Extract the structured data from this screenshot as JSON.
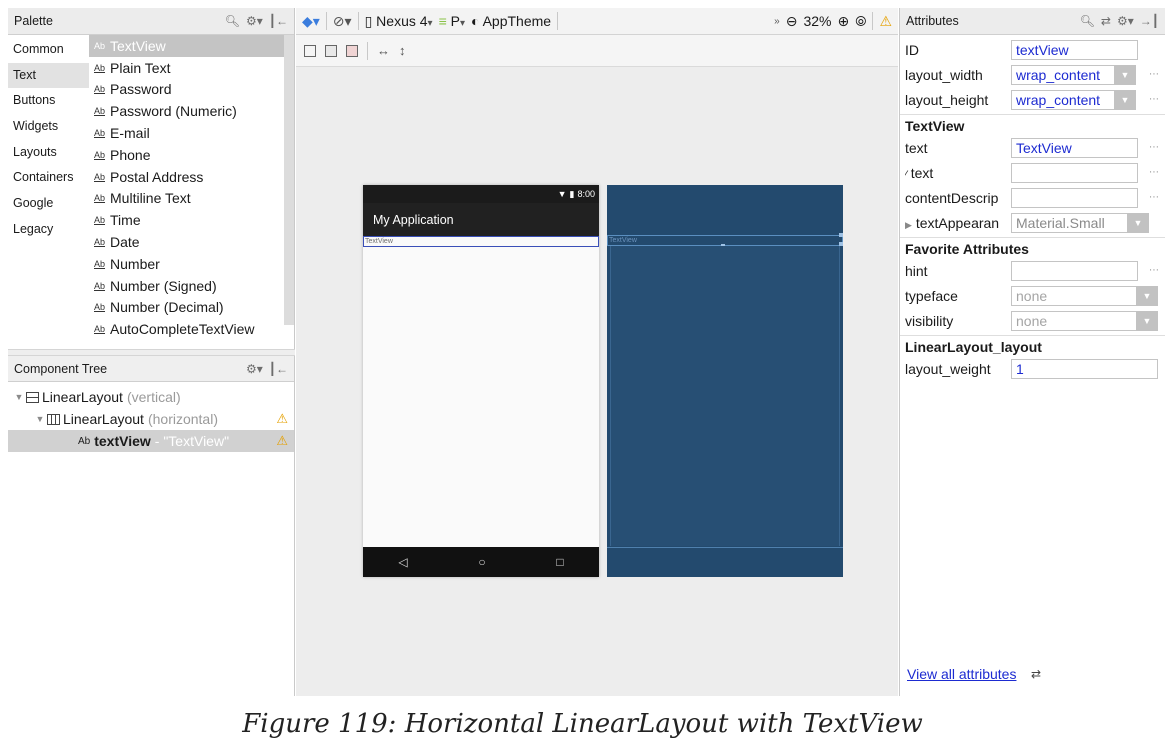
{
  "palette": {
    "title": "Palette",
    "categories": [
      "Common",
      "Text",
      "Buttons",
      "Widgets",
      "Layouts",
      "Containers",
      "Google",
      "Legacy"
    ],
    "selected_category": "Text",
    "items": [
      {
        "label": "TextView",
        "ab": "Ab"
      },
      {
        "label": "Plain Text",
        "ab": "Ab"
      },
      {
        "label": "Password",
        "ab": "Ab"
      },
      {
        "label": "Password (Numeric)",
        "ab": "Ab"
      },
      {
        "label": "E-mail",
        "ab": "Ab"
      },
      {
        "label": "Phone",
        "ab": "Ab"
      },
      {
        "label": "Postal Address",
        "ab": "Ab"
      },
      {
        "label": "Multiline Text",
        "ab": "Ab"
      },
      {
        "label": "Time",
        "ab": "Ab"
      },
      {
        "label": "Date",
        "ab": "Ab"
      },
      {
        "label": "Number",
        "ab": "Ab"
      },
      {
        "label": "Number (Signed)",
        "ab": "Ab"
      },
      {
        "label": "Number (Decimal)",
        "ab": "Ab"
      },
      {
        "label": "AutoCompleteTextView",
        "ab": "Ab"
      }
    ]
  },
  "component_tree": {
    "title": "Component Tree",
    "nodes": [
      {
        "name": "LinearLayout",
        "hint": "(vertical)"
      },
      {
        "name": "LinearLayout",
        "hint": "(horizontal)"
      },
      {
        "name": "textView",
        "hint": "- \"TextView\"",
        "ab": "Ab"
      }
    ]
  },
  "toolbar": {
    "device": "Nexus 4",
    "api": "P",
    "theme": "AppTheme",
    "zoom": "32%"
  },
  "preview": {
    "time": "8:00",
    "app_title": "My Application",
    "textview_text": "TextView",
    "blueprint_text": "TextView"
  },
  "attributes": {
    "title": "Attributes",
    "id_label": "ID",
    "id_value": "textView",
    "layout_width_label": "layout_width",
    "layout_width_value": "wrap_content",
    "layout_height_label": "layout_height",
    "layout_height_value": "wrap_content",
    "textview_section": "TextView",
    "text_label": "text",
    "text_value": "TextView",
    "text_tools_label": "text",
    "content_desc_label": "contentDescrip",
    "text_appearance_label": "textAppearan",
    "text_appearance_value": "Material.Small",
    "favorite_section": "Favorite Attributes",
    "hint_label": "hint",
    "typeface_label": "typeface",
    "typeface_value": "none",
    "visibility_label": "visibility",
    "visibility_value": "none",
    "ll_section": "LinearLayout_layout",
    "weight_label": "layout_weight",
    "weight_value": "1",
    "view_all": "View all attributes"
  },
  "caption": "Figure 119: Horizontal LinearLayout with TextView"
}
